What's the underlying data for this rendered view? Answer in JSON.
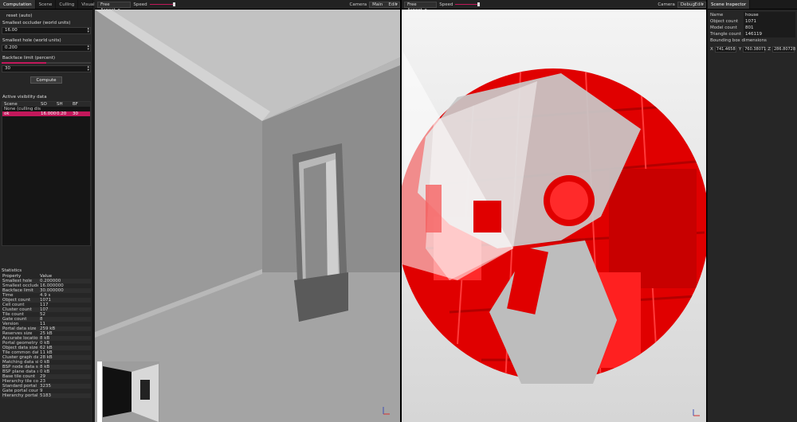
{
  "left_tabs": [
    "Computation",
    "Scene",
    "Culling",
    "Visualizations"
  ],
  "computation": {
    "reset_label": "reset (auto)",
    "smallest_occluder_label": "Smallest occluder (world units)",
    "smallest_occluder_value": "16.00",
    "smallest_hole_label": "Smallest hole (world units)",
    "smallest_hole_value": "0.200",
    "backface_label": "Backface limit (percent)",
    "backface_value": "30",
    "compute_label": "Compute"
  },
  "visibility": {
    "title": "Active visibility data",
    "headers": [
      "Scene",
      "SO",
      "SH",
      "BF"
    ],
    "rows": [
      [
        "None (culling disabl..",
        "",
        "",
        ""
      ],
      [
        "ok",
        "16.000",
        "0.20",
        "30"
      ]
    ]
  },
  "statistics": {
    "title": "Statistics",
    "headers": [
      "Property",
      "Value"
    ],
    "rows": [
      [
        "Smallest hole",
        "0.200000"
      ],
      [
        "Smallest occluder",
        "16.000000"
      ],
      [
        "Backface limit",
        "30.000000"
      ],
      [
        "Time",
        "4.9 s"
      ],
      [
        "Object count",
        "1071"
      ],
      [
        "Cell count",
        "117"
      ],
      [
        "Cluster count",
        "107"
      ],
      [
        "Tile count",
        "52"
      ],
      [
        "Gate count",
        "8"
      ],
      [
        "Version",
        "11"
      ],
      [
        "Portal data size",
        "259 kB"
      ],
      [
        "Reserves size",
        "25 kB"
      ],
      [
        "Accurate location s..",
        "8 kB"
      ],
      [
        "Portal geometry size",
        "0 kB"
      ],
      [
        "Object data size",
        "62 kB"
      ],
      [
        "Tile common data",
        "11 kB"
      ],
      [
        "Cluster graph data",
        "28 kB"
      ],
      [
        "Matching data size",
        "0 kB"
      ],
      [
        "BSP node data size",
        "8 kB"
      ],
      [
        "BSP plane data size",
        "0 kB"
      ],
      [
        "Base tile count",
        "29"
      ],
      [
        "Hierarchy tile count",
        "23"
      ],
      [
        "Standard portal cou..",
        "3235"
      ],
      [
        "Gate portal count",
        "9"
      ],
      [
        "Hierarchy portal co..",
        "5183"
      ]
    ]
  },
  "main_viewport": {
    "aspect": "Free Aspect",
    "speed_label": "Speed",
    "camera_label": "Camera",
    "camera_value": "Main",
    "edit_label": "Edit"
  },
  "debug_viewport": {
    "aspect": "Free Aspect",
    "speed_label": "Speed",
    "camera_label": "Camera",
    "camera_value": "Debug",
    "edit_label": "Edit"
  },
  "inspector": {
    "tab": "Scene Inspector",
    "rows": [
      [
        "Name",
        "house"
      ],
      [
        "Object count",
        "1071"
      ],
      [
        "Model count",
        "801"
      ],
      [
        "Triangle count",
        "146119"
      ]
    ],
    "bbox_label": "Bounding box dimensions",
    "bbox": [
      {
        "axis": "X",
        "value": "741.4658"
      },
      {
        "axis": "Y",
        "value": "760.38071"
      },
      {
        "axis": "Z",
        "value": "286.80728"
      }
    ]
  },
  "colors": {
    "accent": "#c2185b",
    "occluder_red": "#e00000"
  }
}
